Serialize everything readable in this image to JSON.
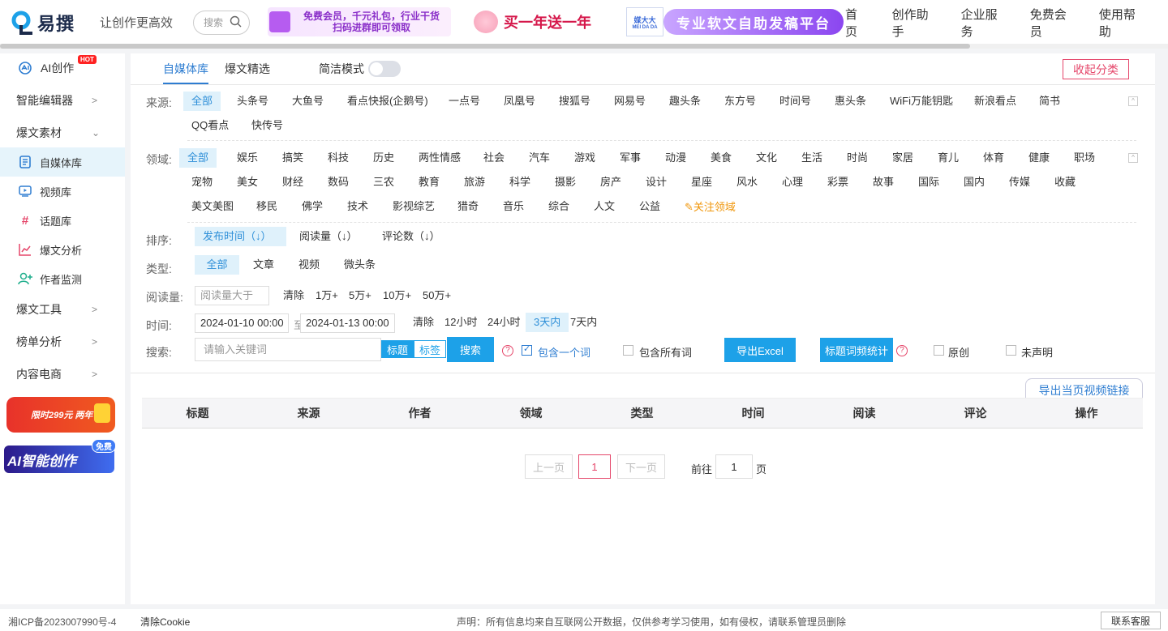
{
  "header": {
    "logo_text": "易撰",
    "slogan": "让创作更高效",
    "search_placeholder": "搜索",
    "banner1_line1": "免费会员，千元礼包，行业干货",
    "banner1_line2": "扫码进群即可领取",
    "banner2": "买一年送一年",
    "banner3_logo": "媒大大",
    "banner3_logo_sub": "MEI DA DA",
    "banner3": "专业软文自助发稿平台",
    "nav": [
      "首页",
      "创作助手",
      "企业服务",
      "免费会员",
      "使用帮助"
    ]
  },
  "sidebar": {
    "ai": "AI创作",
    "hot": "HOT",
    "editor": "智能编辑器",
    "material": "爆文素材",
    "subs": [
      "自媒体库",
      "视频库",
      "话题库",
      "爆文分析",
      "作者监测"
    ],
    "tools": "爆文工具",
    "rank": "榜单分析",
    "ecom": "内容电商",
    "promo1": "限时299元 两年",
    "promo2": "AI智能创作",
    "promo2_badge": "免费"
  },
  "main": {
    "tabs": [
      "自媒体库",
      "爆文精选"
    ],
    "simple_mode": "简洁模式",
    "collapse": "收起分类",
    "source_label": "来源:",
    "sources": [
      "全部",
      "头条号",
      "大鱼号",
      "看点快报(企鹅号)",
      "一点号",
      "凤凰号",
      "搜狐号",
      "网易号",
      "趣头条",
      "东方号",
      "时间号",
      "惠头条",
      "WiFi万能钥匙",
      "新浪看点",
      "简书",
      "QQ看点",
      "快传号"
    ],
    "domain_label": "领域:",
    "domains_row1": [
      "全部",
      "娱乐",
      "搞笑",
      "科技",
      "历史",
      "两性情感",
      "社会",
      "汽车",
      "游戏",
      "军事",
      "动漫",
      "美食",
      "文化",
      "生活",
      "时尚",
      "家居",
      "育儿",
      "体育",
      "健康",
      "职场"
    ],
    "domains_row2": [
      "宠物",
      "美女",
      "财经",
      "数码",
      "三农",
      "教育",
      "旅游",
      "科学",
      "摄影",
      "房产",
      "设计",
      "星座",
      "风水",
      "心理",
      "彩票",
      "故事",
      "国际",
      "国内",
      "传媒",
      "收藏"
    ],
    "domains_row3": [
      "美文美图",
      "移民",
      "佛学",
      "技术",
      "影视综艺",
      "猎奇",
      "音乐",
      "综合",
      "人文",
      "公益"
    ],
    "follow_domain": "关注领域",
    "sort_label": "排序:",
    "sorts": [
      "发布时间（↓）",
      "阅读量（↓）",
      "评论数（↓）"
    ],
    "type_label": "类型:",
    "types": [
      "全部",
      "文章",
      "视频",
      "微头条"
    ],
    "read_label": "阅读量:",
    "read_placeholder": "阅读量大于",
    "read_opts": [
      "清除",
      "1万+",
      "5万+",
      "10万+",
      "50万+"
    ],
    "time_label": "时间:",
    "time_start": "2024-01-10 00:00",
    "time_to": "至",
    "time_end": "2024-01-13 00:00",
    "time_opts": [
      "清除",
      "12小时",
      "24小时",
      "3天内",
      "7天内"
    ],
    "search_label": "搜索:",
    "keyword_placeholder": "请输入关键词",
    "title_tag": "标题",
    "label_tag": "标签",
    "search_btn": "搜索",
    "help": "?",
    "contains_one": "包含一个词",
    "contains_all": "包含所有词",
    "export_excel": "导出Excel",
    "word_freq": "标题词频统计",
    "original": "原创",
    "undeclared": "未声明",
    "export_video": "导出当页视频链接",
    "columns": [
      "标题",
      "来源",
      "作者",
      "领域",
      "类型",
      "时间",
      "阅读",
      "评论",
      "操作"
    ],
    "prev": "上一页",
    "page": "1",
    "next": "下一页",
    "goto": "前往",
    "goto_value": "1",
    "page_unit": "页"
  },
  "footer": {
    "icp": "湘ICP备2023007990号-4",
    "cookie": "清除Cookie",
    "notice": "声明：所有信息均来自互联网公开数据，仅供参考学习使用，如有侵权，请联系管理员删除",
    "support": "联系客服"
  },
  "colors": {
    "accent": "#2e7dd1",
    "active_bg": "#dff1fb",
    "pink": "#e5466a",
    "button": "#1da1e8"
  }
}
